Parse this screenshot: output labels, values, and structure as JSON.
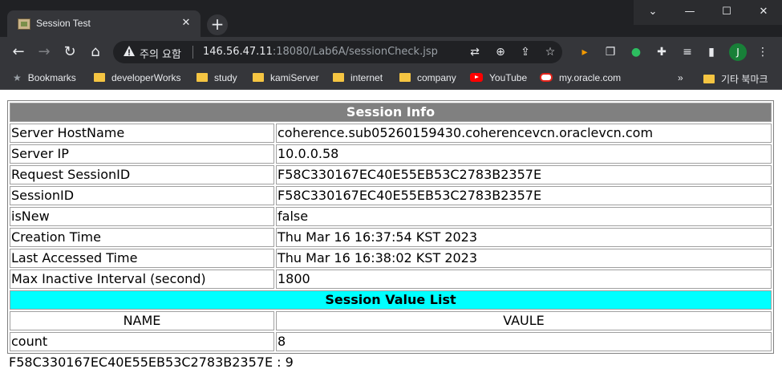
{
  "browser": {
    "tab_title": "Session Test",
    "tab_close": "✕",
    "new_tab": "+",
    "window_controls": {
      "minimize": "—",
      "restore": "☐",
      "close": "✕",
      "dropdown": "⌄"
    },
    "omnibox": {
      "security_label": "주의 요함",
      "url_host": "146.56.47.11",
      "url_rest": ":18080/Lab6A/sessionCheck.jsp"
    },
    "profile_initial": "J",
    "bookmarks": [
      {
        "label": "Bookmarks",
        "icon": "star-icon"
      },
      {
        "label": "developerWorks",
        "icon": "folder-icon"
      },
      {
        "label": "study",
        "icon": "folder-icon"
      },
      {
        "label": "kamiServer",
        "icon": "folder-icon"
      },
      {
        "label": "internet",
        "icon": "folder-icon"
      },
      {
        "label": "company",
        "icon": "folder-icon"
      },
      {
        "label": "YouTube",
        "icon": "youtube-icon"
      },
      {
        "label": "my.oracle.com",
        "icon": "oracle-icon"
      }
    ],
    "bookmarks_overflow": "»",
    "other_bookmarks": "기타 북마크"
  },
  "session_info": {
    "heading": "Session Info",
    "rows": [
      {
        "label": "Server HostName",
        "value": "coherence.sub05260159430.coherencevcn.oraclevcn.com"
      },
      {
        "label": "Server IP",
        "value": "10.0.0.58"
      },
      {
        "label": "Request SessionID",
        "value": "F58C330167EC40E55EB53C2783B2357E"
      },
      {
        "label": "SessionID",
        "value": "F58C330167EC40E55EB53C2783B2357E"
      },
      {
        "label": "isNew",
        "value": "false"
      },
      {
        "label": "Creation Time",
        "value": "Thu Mar 16 16:37:54 KST 2023"
      },
      {
        "label": "Last Accessed Time",
        "value": "Thu Mar 16 16:38:02 KST 2023"
      },
      {
        "label": "Max Inactive Interval (second)",
        "value": "1800"
      }
    ]
  },
  "session_values": {
    "heading": "Session Value List",
    "columns": [
      "NAME",
      "VAULE"
    ],
    "rows": [
      {
        "name": "count",
        "value": "8"
      }
    ]
  },
  "footer_text": "F58C330167EC40E55EB53C2783B2357E : 9",
  "colors": {
    "section_header_bg": "#808080",
    "value_header_bg": "#00ffff",
    "chrome_dark": "#202124",
    "chrome_toolbar": "#35363a"
  }
}
